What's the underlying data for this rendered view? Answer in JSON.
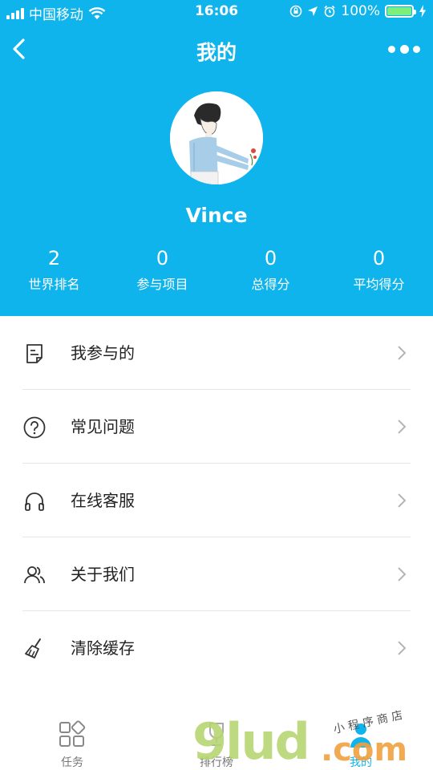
{
  "status_bar": {
    "carrier": "中国移动",
    "time": "16:06",
    "battery": "100%"
  },
  "nav": {
    "title": "我的"
  },
  "profile": {
    "username": "Vince"
  },
  "stats": [
    {
      "value": "2",
      "label": "世界排名"
    },
    {
      "value": "0",
      "label": "参与项目"
    },
    {
      "value": "0",
      "label": "总得分"
    },
    {
      "value": "0",
      "label": "平均得分"
    }
  ],
  "menu": [
    {
      "label": "我参与的",
      "icon": "document-icon"
    },
    {
      "label": "常见问题",
      "icon": "question-icon"
    },
    {
      "label": "在线客服",
      "icon": "headphones-icon"
    },
    {
      "label": "关于我们",
      "icon": "users-icon"
    },
    {
      "label": "清除缓存",
      "icon": "broom-icon"
    }
  ],
  "tabs": [
    {
      "label": "任务",
      "icon": "grid-icon"
    },
    {
      "label": "排行榜",
      "icon": "trophy-icon"
    },
    {
      "label": "我的",
      "icon": "person-icon",
      "active": true
    }
  ],
  "watermark": {
    "main": "9lud",
    "suffix": ".com",
    "small": "小 程 序 商 店"
  },
  "colors": {
    "primary": "#0fb4ec",
    "battery_fill": "#7ef07a",
    "divider": "#e6e6e6"
  }
}
